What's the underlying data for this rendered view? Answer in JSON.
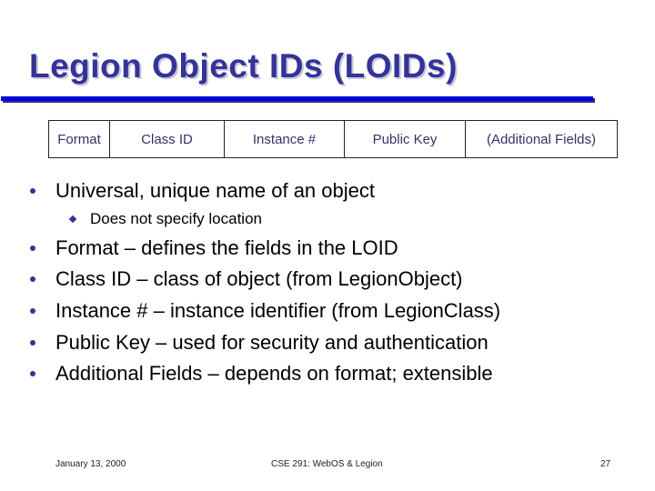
{
  "slide": {
    "title": "Legion Object IDs (LOIDs)",
    "accent_color": "#333399",
    "rule_color": "#0000e0"
  },
  "loid_structure": {
    "fields": [
      "Format",
      "Class ID",
      "Instance #",
      "Public Key",
      "(Additional Fields)"
    ]
  },
  "bullets": [
    {
      "text": "Universal, unique name of an object",
      "sub": [
        "Does not specify location"
      ]
    },
    {
      "text": "Format – defines the fields in the LOID",
      "sub": []
    },
    {
      "text": "Class ID – class of object (from LegionObject)",
      "sub": []
    },
    {
      "text": "Instance # – instance identifier (from LegionClass)",
      "sub": []
    },
    {
      "text": "Public Key – used for security and authentication",
      "sub": []
    },
    {
      "text": "Additional Fields – depends on format; extensible",
      "sub": []
    }
  ],
  "footer": {
    "date": "January 13, 2000",
    "course": "CSE 291: WebOS & Legion",
    "page_number": "27"
  }
}
